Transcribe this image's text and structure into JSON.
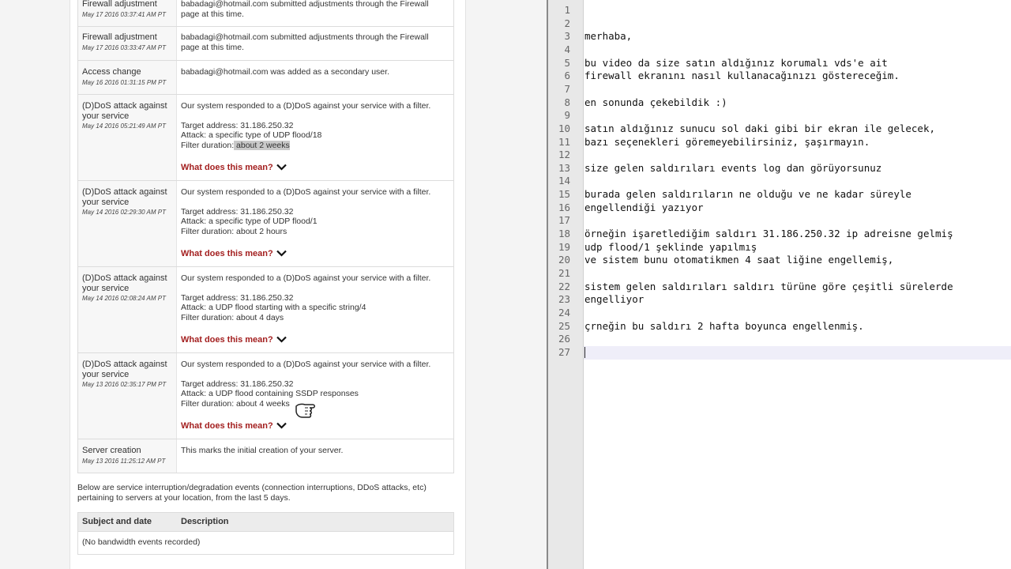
{
  "events": [
    {
      "subject": "Firewall adjustment",
      "date": "May 17 2016 03:37:41 AM PT",
      "lines": [
        "babadagi@hotmail.com submitted adjustments through the Firewall",
        "page at this time."
      ]
    },
    {
      "subject": "Firewall adjustment",
      "date": "May 17 2016 03:33:47 AM PT",
      "lines": [
        "babadagi@hotmail.com submitted adjustments through the Firewall",
        "page at this time."
      ]
    },
    {
      "subject": "Access change",
      "date": "May 16 2016 01:31:15 PM PT",
      "lines": [
        "babadagi@hotmail.com was added as a secondary user."
      ]
    },
    {
      "subject": "(D)DoS attack against your service",
      "date": "May 14 2016 05:21:49 AM PT",
      "intro": "Our system responded to a (D)DoS against your service with a filter.",
      "target": "Target address: 31.186.250.32",
      "attack": "Attack: a specific type of UDP flood/18",
      "duration_label": "Filter duration:",
      "duration_value": " about 2 weeks",
      "link": "What does this mean?"
    },
    {
      "subject": "(D)DoS attack against your service",
      "date": "May 14 2016 02:29:30 AM PT",
      "intro": "Our system responded to a (D)DoS against your service with a filter.",
      "target": "Target address: 31.186.250.32",
      "attack": "Attack: a specific type of UDP flood/1",
      "duration_label": "Filter duration:",
      "duration_value": " about 2 hours",
      "link": "What does this mean?"
    },
    {
      "subject": "(D)DoS attack against your service",
      "date": "May 14 2016 02:08:24 AM PT",
      "intro": "Our system responded to a (D)DoS against your service with a filter.",
      "target": "Target address: 31.186.250.32",
      "attack": "Attack: a UDP flood starting with a specific string/4",
      "duration_label": "Filter duration:",
      "duration_value": " about 4 days",
      "link": "What does this mean?"
    },
    {
      "subject": "(D)DoS attack against your service",
      "date": "May 13 2016 02:35:17 PM PT",
      "intro": "Our system responded to a (D)DoS against your service with a filter.",
      "target": "Target address: 31.186.250.32",
      "attack": "Attack: a UDP flood containing SSDP responses",
      "duration_label": "Filter duration:",
      "duration_value": " about 4 weeks",
      "link": "What does this mean?"
    },
    {
      "subject": "Server creation",
      "date": "May 13 2016 11:25:12 AM PT",
      "lines": [
        "This marks the initial creation of your server."
      ]
    }
  ],
  "bandwidth": {
    "note": "Below are service interruption/degradation events (connection interruptions, DDoS attacks, etc) pertaining to servers at your location, from the last 5 days.",
    "col_subject": "Subject and date",
    "col_description": "Description",
    "empty": "(No bandwidth events recorded)"
  },
  "editor": {
    "line_numbers": [
      "1",
      "2",
      "3",
      "4",
      "5",
      "6",
      "7",
      "8",
      "9",
      "10",
      "11",
      "12",
      "13",
      "14",
      "15",
      "16",
      "17",
      "18",
      "19",
      "20",
      "21",
      "22",
      "23",
      "24",
      "25",
      "26",
      "27"
    ],
    "lines": [
      "",
      "",
      "merhaba,",
      "",
      "bu video da size satın aldığınız korumalı vds'e ait",
      "firewall ekranını nasıl kullanacağınızı göstereceğim.",
      "",
      "en sonunda çekebildik :)",
      "",
      "satın aldığınız sunucu sol daki gibi bir ekran ile gelecek,",
      "bazı seçenekleri göremeyebilirsiniz, şaşırmayın.",
      "",
      "size gelen saldırıları events log dan görüyorsunuz",
      "",
      "burada gelen saldırıların ne olduğu ve ne kadar süreyle",
      "engellendiği yazıyor",
      "",
      "örneğin işaretlediğim saldırı 31.186.250.32 ip adreisne gelmiş",
      "udp flood/1 şeklinde yapılmış",
      "ve sistem bunu otomatikmen 4 saat liğine engellemiş,",
      "",
      "sistem gelen saldırıları saldırı türüne göre çeşitli sürelerde",
      "engelliyor",
      "",
      "çrneğin bu saldırı 2 hafta boyunca engellenmiş.",
      "",
      ""
    ],
    "current_line": 27
  },
  "colors": {
    "link": "#a31f1f",
    "highlight": "#c9c9c9",
    "current_line": "#efeef9"
  },
  "icons": {
    "expand": "chevron-down-icon",
    "cursor": "hand-pointer-icon"
  }
}
